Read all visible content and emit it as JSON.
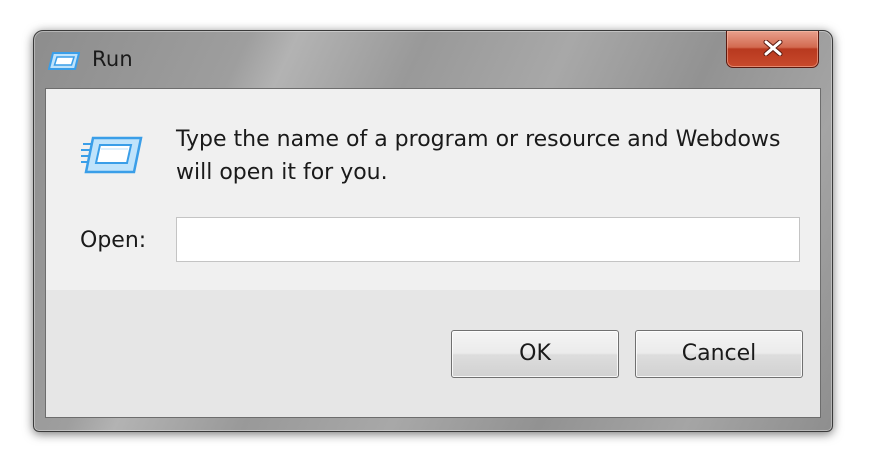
{
  "window": {
    "title": "Run",
    "title_icon": "run-icon",
    "close_icon": "close-icon"
  },
  "dialog": {
    "message": "Type the name of a program or resource and Webdows will open it for you.",
    "icon": "run-icon",
    "open_label": "Open:",
    "open_value": "",
    "ok_label": "OK",
    "cancel_label": "Cancel"
  },
  "colors": {
    "icon_blue": "#3a9ee8",
    "close_red": "#c84a2c",
    "client_bg": "#f0f0f0"
  }
}
